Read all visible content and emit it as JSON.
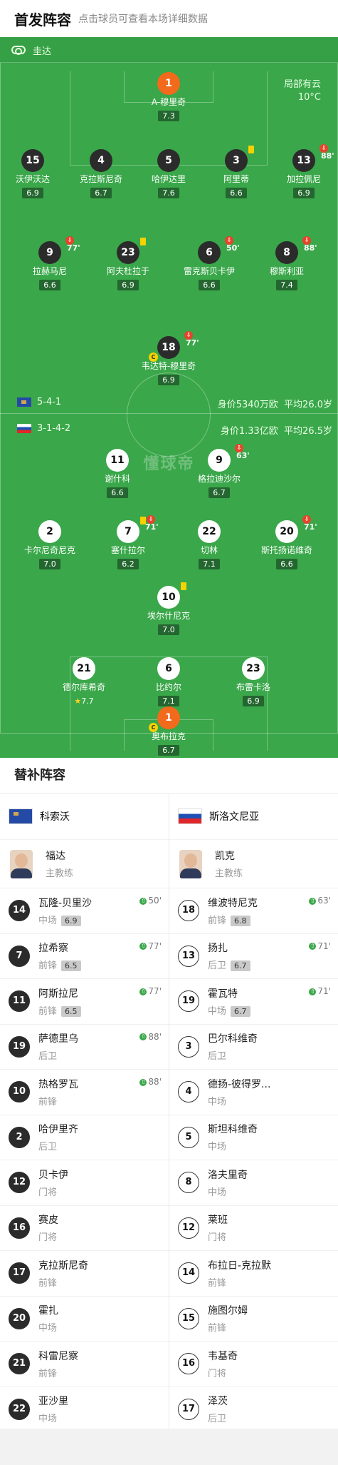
{
  "header": {
    "title": "首发阵容",
    "hint": "点击球员可查看本场详细数据"
  },
  "referee": {
    "name": "圭达"
  },
  "weather": {
    "line1": "局部有云",
    "line2": "10°C"
  },
  "watermark": "懂球帝",
  "kosovo": {
    "formation": "5-4-1",
    "value": "身价5340万欧",
    "age": "平均26.0岁"
  },
  "slovenia": {
    "formation": "3-1-4-2",
    "value": "身价1.33亿欧",
    "age": "平均26.5岁"
  },
  "kosovo_players": [
    {
      "num": "1",
      "name": "A-穆里奇",
      "rating": "7.3"
    },
    {
      "num": "15",
      "name": "沃伊沃达",
      "rating": "6.9"
    },
    {
      "num": "4",
      "name": "克拉斯尼奇",
      "rating": "6.7"
    },
    {
      "num": "5",
      "name": "哈伊达里",
      "rating": "7.6"
    },
    {
      "num": "3",
      "name": "阿里蒂",
      "rating": "6.6"
    },
    {
      "num": "13",
      "name": "加拉佩尼",
      "rating": "6.9",
      "sub": "88'"
    },
    {
      "num": "9",
      "name": "拉赫马尼",
      "rating": "6.6",
      "sub": "77'"
    },
    {
      "num": "23",
      "name": "阿夫杜拉于",
      "rating": "6.9"
    },
    {
      "num": "6",
      "name": "雷克斯贝卡伊",
      "rating": "6.6",
      "sub": "50'"
    },
    {
      "num": "8",
      "name": "穆斯利亚",
      "rating": "7.4",
      "sub": "88'"
    },
    {
      "num": "18",
      "name": "韦达特-穆里奇",
      "rating": "6.9",
      "sub": "77'"
    }
  ],
  "slovenia_players": [
    {
      "num": "11",
      "name": "谢什科",
      "rating": "6.6"
    },
    {
      "num": "9",
      "name": "格拉迪沙尔",
      "rating": "6.7",
      "sub": "63'"
    },
    {
      "num": "2",
      "name": "卡尔尼奇尼克",
      "rating": "7.0"
    },
    {
      "num": "7",
      "name": "塞什拉尔",
      "rating": "6.2",
      "sub": "71'"
    },
    {
      "num": "22",
      "name": "切林",
      "rating": "7.1"
    },
    {
      "num": "20",
      "name": "斯托扬诺维奇",
      "rating": "6.6",
      "sub": "71'"
    },
    {
      "num": "10",
      "name": "埃尔什尼克",
      "rating": "7.0"
    },
    {
      "num": "21",
      "name": "德尔库希奇",
      "rating": "7.7"
    },
    {
      "num": "6",
      "name": "比约尔",
      "rating": "7.1"
    },
    {
      "num": "23",
      "name": "布雷卡洛",
      "rating": "6.9"
    },
    {
      "num": "1",
      "name": "奥布拉克",
      "rating": "6.7"
    }
  ],
  "subs": {
    "title": "替补阵容",
    "left": {
      "team": "科索沃",
      "coach": {
        "name": "福达",
        "role": "主教练"
      },
      "players": [
        {
          "num": "14",
          "name": "瓦隆-贝里沙",
          "pos": "中场",
          "rating": "6.9",
          "in": "50'"
        },
        {
          "num": "7",
          "name": "拉希察",
          "pos": "前锋",
          "rating": "6.5",
          "in": "77'"
        },
        {
          "num": "11",
          "name": "阿斯拉尼",
          "pos": "前锋",
          "rating": "6.5",
          "in": "77'"
        },
        {
          "num": "19",
          "name": "萨德里乌",
          "pos": "后卫",
          "in": "88'"
        },
        {
          "num": "10",
          "name": "热格罗瓦",
          "pos": "前锋",
          "in": "88'"
        },
        {
          "num": "2",
          "name": "哈伊里齐",
          "pos": "后卫"
        },
        {
          "num": "12",
          "name": "贝卡伊",
          "pos": "门将"
        },
        {
          "num": "16",
          "name": "赛皮",
          "pos": "门将"
        },
        {
          "num": "17",
          "name": "克拉斯尼奇",
          "pos": "前锋"
        },
        {
          "num": "20",
          "name": "霍扎",
          "pos": "中场"
        },
        {
          "num": "21",
          "name": "科雷尼察",
          "pos": "前锋"
        },
        {
          "num": "22",
          "name": "亚沙里",
          "pos": "中场"
        }
      ]
    },
    "right": {
      "team": "斯洛文尼亚",
      "coach": {
        "name": "凯克",
        "role": "主教练"
      },
      "players": [
        {
          "num": "18",
          "name": "维波特尼克",
          "pos": "前锋",
          "rating": "6.8",
          "in": "63'"
        },
        {
          "num": "13",
          "name": "扬扎",
          "pos": "后卫",
          "rating": "6.7",
          "in": "71'"
        },
        {
          "num": "19",
          "name": "霍瓦特",
          "pos": "中场",
          "rating": "6.7",
          "in": "71'"
        },
        {
          "num": "3",
          "name": "巴尔科维奇",
          "pos": "后卫"
        },
        {
          "num": "4",
          "name": "德扬-彼得罗...",
          "pos": "中场"
        },
        {
          "num": "5",
          "name": "斯坦科维奇",
          "pos": "中场"
        },
        {
          "num": "8",
          "name": "洛夫里奇",
          "pos": "中场"
        },
        {
          "num": "12",
          "name": "莱班",
          "pos": "门将"
        },
        {
          "num": "14",
          "name": "布拉日-克拉默",
          "pos": "前锋"
        },
        {
          "num": "15",
          "name": "施图尔姆",
          "pos": "前锋"
        },
        {
          "num": "16",
          "name": "韦基奇",
          "pos": "门将"
        },
        {
          "num": "17",
          "name": "泽茨",
          "pos": "后卫"
        }
      ]
    }
  }
}
